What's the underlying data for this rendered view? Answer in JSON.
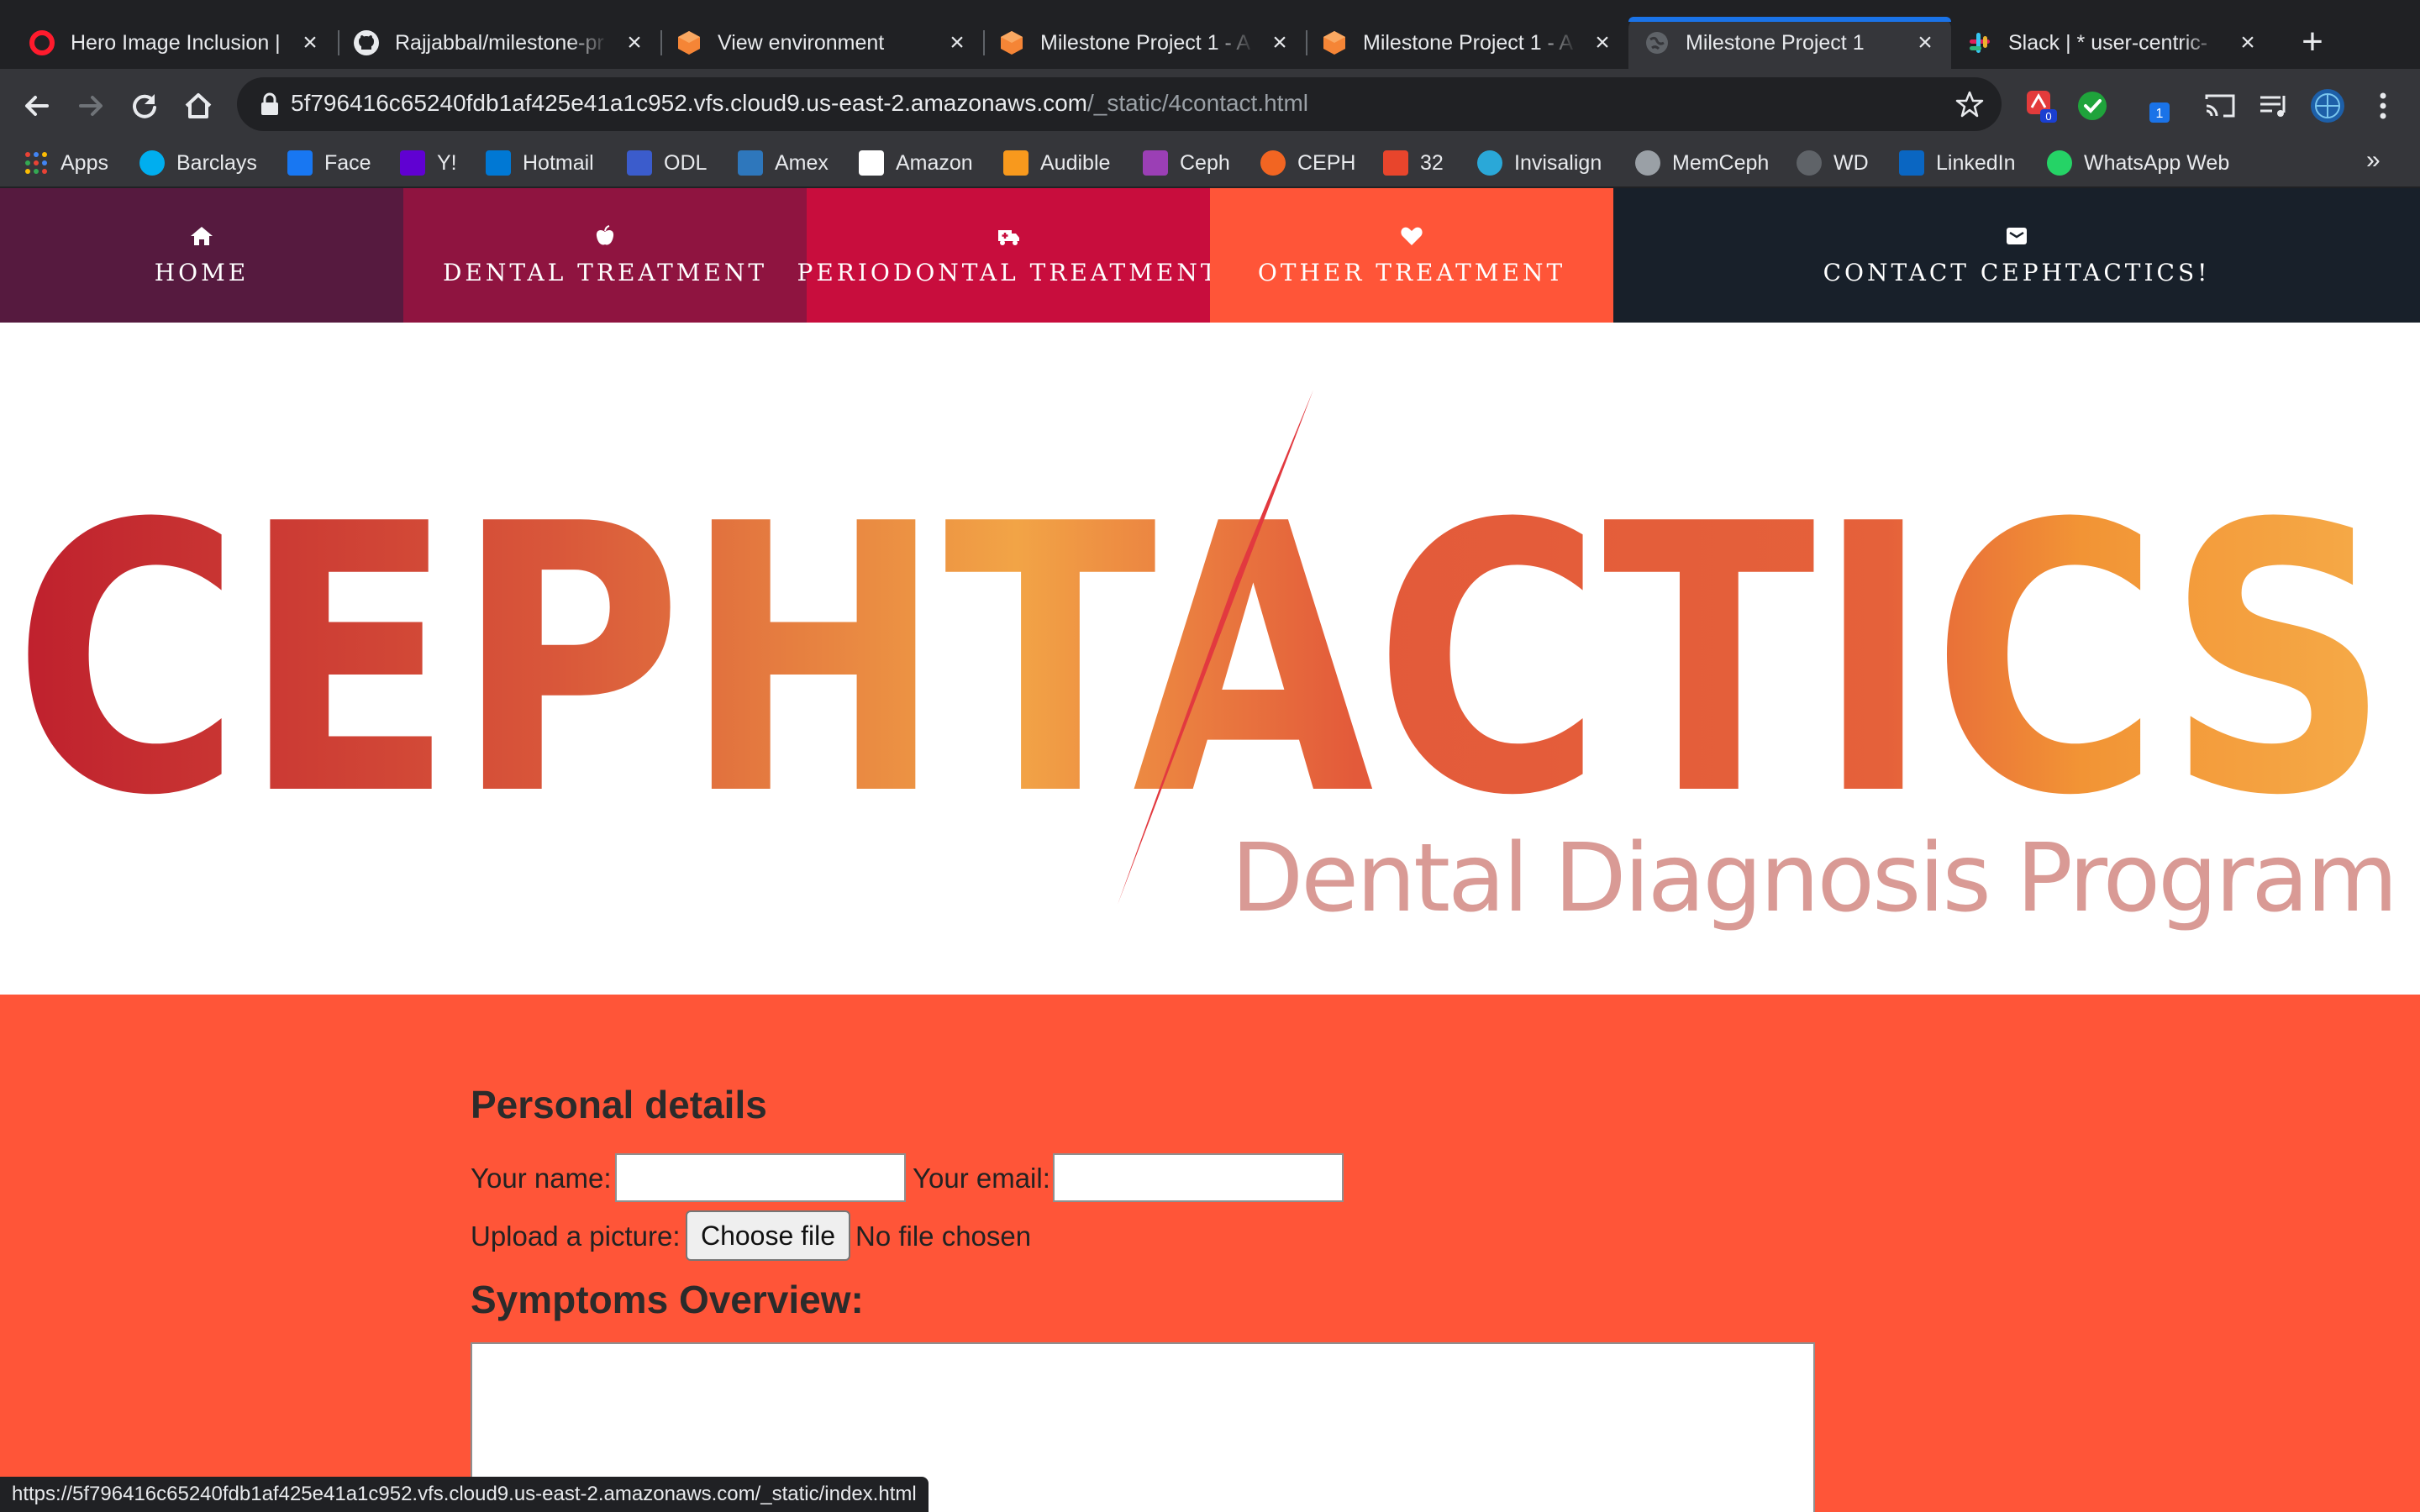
{
  "browser": {
    "tabs": [
      {
        "title": "Hero Image Inclusion |",
        "icon": "opera-icon",
        "close": "×"
      },
      {
        "title": "Rajjabbal/milestone-pr",
        "icon": "github-icon",
        "close": "×"
      },
      {
        "title": "View environment",
        "icon": "aws-cube-icon",
        "close": "×"
      },
      {
        "title": "Milestone Project 1 - A",
        "icon": "aws-cube-icon",
        "close": "×"
      },
      {
        "title": "Milestone Project 1 - A",
        "icon": "aws-cube-icon",
        "close": "×"
      },
      {
        "title": "Milestone Project 1",
        "icon": "globe-icon",
        "close": "×"
      },
      {
        "title": "Slack | * user-centric-",
        "icon": "slack-icon",
        "close": "×"
      }
    ],
    "new_tab": "+",
    "url_host": "5f796416c65240fdb1af425e41a1c952.vfs.cloud9.us-east-2.amazonaws.com",
    "url_path": "/_static/4contact.html",
    "ext_badge_count": "0",
    "ext_badge_count_2": "1",
    "bookmarks": [
      {
        "label": "Apps",
        "color": "#e8eaed"
      },
      {
        "label": "Barclays",
        "color": "#00aeef"
      },
      {
        "label": "Face",
        "color": "#1877f2"
      },
      {
        "label": "Y!",
        "color": "#6001d2"
      },
      {
        "label": "Hotmail",
        "color": "#0078d4"
      },
      {
        "label": "ODL",
        "color": "#3b5ccc"
      },
      {
        "label": "Amex",
        "color": "#2e77bc"
      },
      {
        "label": "Amazon",
        "color": "#ffffff"
      },
      {
        "label": "Audible",
        "color": "#f8991d"
      },
      {
        "label": "Ceph",
        "color": "#9b3fb5"
      },
      {
        "label": "CEPH",
        "color": "#f26522"
      },
      {
        "label": "32",
        "color": "#e8452c"
      },
      {
        "label": "Invisalign",
        "color": "#2aa8d8"
      },
      {
        "label": "MemCeph",
        "color": "#9aa0a6"
      },
      {
        "label": "WD",
        "color": "#5f6368"
      },
      {
        "label": "LinkedIn",
        "color": "#0a66c2"
      },
      {
        "label": "WhatsApp Web",
        "color": "#25d366"
      }
    ],
    "bookmarks_more": "»",
    "status_url": "https://5f796416c65240fdb1af425e41a1c952.vfs.cloud9.us-east-2.amazonaws.com/_static/index.html"
  },
  "site_nav": [
    {
      "label": "Home",
      "icon": "home-icon",
      "color": "#561a3f"
    },
    {
      "label": "Dental Treatment",
      "icon": "apple-icon",
      "color": "#8f1440"
    },
    {
      "label": "Periodontal Treatment",
      "icon": "ambulance-icon",
      "color": "#c80d3d"
    },
    {
      "label": "Other Treatment",
      "icon": "heart-icon",
      "color": "#ff5538"
    },
    {
      "label": "Contact Cephtactics!",
      "icon": "envelope-icon",
      "color": "#18202a"
    }
  ],
  "logo": {
    "wordmark": "CEPHTACTICS",
    "tagline": "Dental Diagnosis Program",
    "colors": {
      "start": "#be1e2d",
      "mid": "#e8883c",
      "end": "#f6ad4a",
      "accent": "#e2393f",
      "tagline": "#d99a95"
    }
  },
  "form": {
    "title": "Personal details",
    "name_label": "Your name:",
    "name_value": "",
    "email_label": "Your email:",
    "email_value": "",
    "upload_label": "Upload a picture:",
    "file_button": "Choose file",
    "file_status": "No file chosen",
    "symptoms_title": "Symptoms Overview:",
    "symptoms_value": ""
  },
  "colors": {
    "contact_bg": "#ff5538",
    "chrome_dark": "#202124",
    "chrome_mid": "#35363a"
  }
}
